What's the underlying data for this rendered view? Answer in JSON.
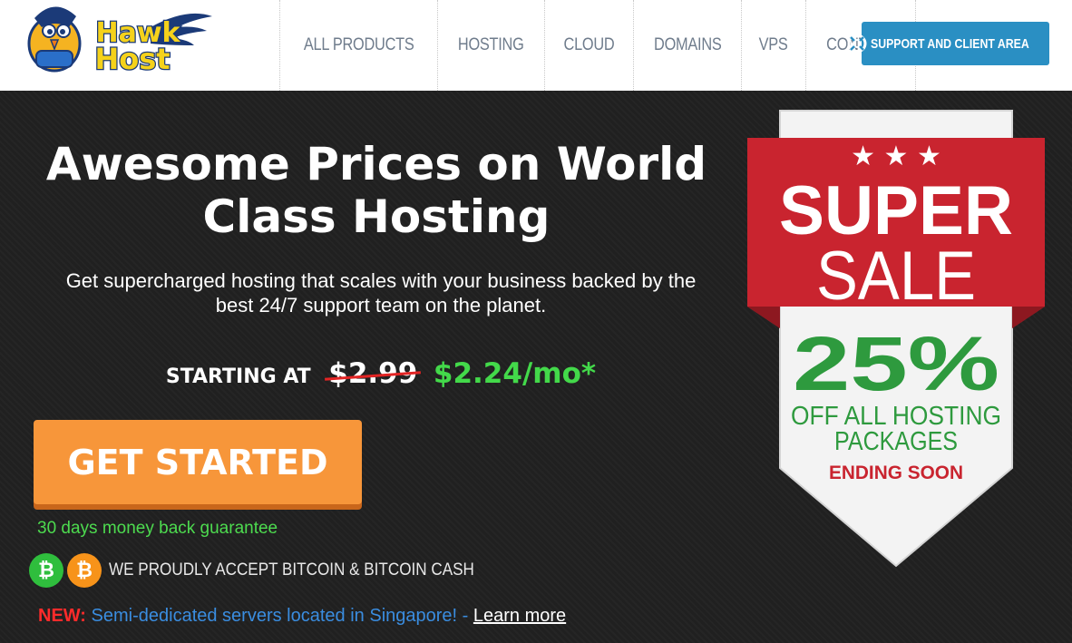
{
  "header": {
    "logo": {
      "line1": "Hawk",
      "line2": "Host"
    },
    "nav": [
      {
        "label": "ALL PRODUCTS"
      },
      {
        "label": "HOSTING"
      },
      {
        "label": "CLOUD"
      },
      {
        "label": "DOMAINS"
      },
      {
        "label": "VPS"
      },
      {
        "label": "CONTACT"
      }
    ],
    "support_button": {
      "label": "SUPPORT AND CLIENT AREA",
      "icon": "lifebuoy-icon"
    }
  },
  "hero": {
    "headline_line1": "Awesome Prices on World",
    "headline_line2": "Class Hosting",
    "subline_line1": "Get supercharged hosting that scales with your business backed by the",
    "subline_line2": "best 24/7 support team on the planet.",
    "starting_label": "STARTING AT",
    "old_price": "$2.99",
    "new_price": "$2.24/mo*",
    "cta_label": "GET STARTED",
    "guarantee": "30 days money back guarantee",
    "crypto": {
      "coins": [
        {
          "name": "bitcoin-cash-icon",
          "glyph": "₿"
        },
        {
          "name": "bitcoin-icon",
          "glyph": "₿"
        }
      ],
      "text": "WE PROUDLY ACCEPT BITCOIN & BITCOIN CASH"
    },
    "news": {
      "tag": "NEW:",
      "message": "Semi-dedicated servers located in Singapore! -",
      "link": "Learn more"
    }
  },
  "sale_badge": {
    "stars": "★ ★ ★",
    "super": "SUPER",
    "sale": "SALE",
    "percent": "25%",
    "off_line1": "OFF ALL HOSTING",
    "off_line2": "PACKAGES",
    "ending": "ENDING SOON"
  },
  "colors": {
    "accent_blue": "#2a8fc3",
    "cta_orange": "#f7963a",
    "price_green": "#43d94a",
    "sale_red": "#c9242f",
    "percent_green": "#2e9a3e"
  }
}
